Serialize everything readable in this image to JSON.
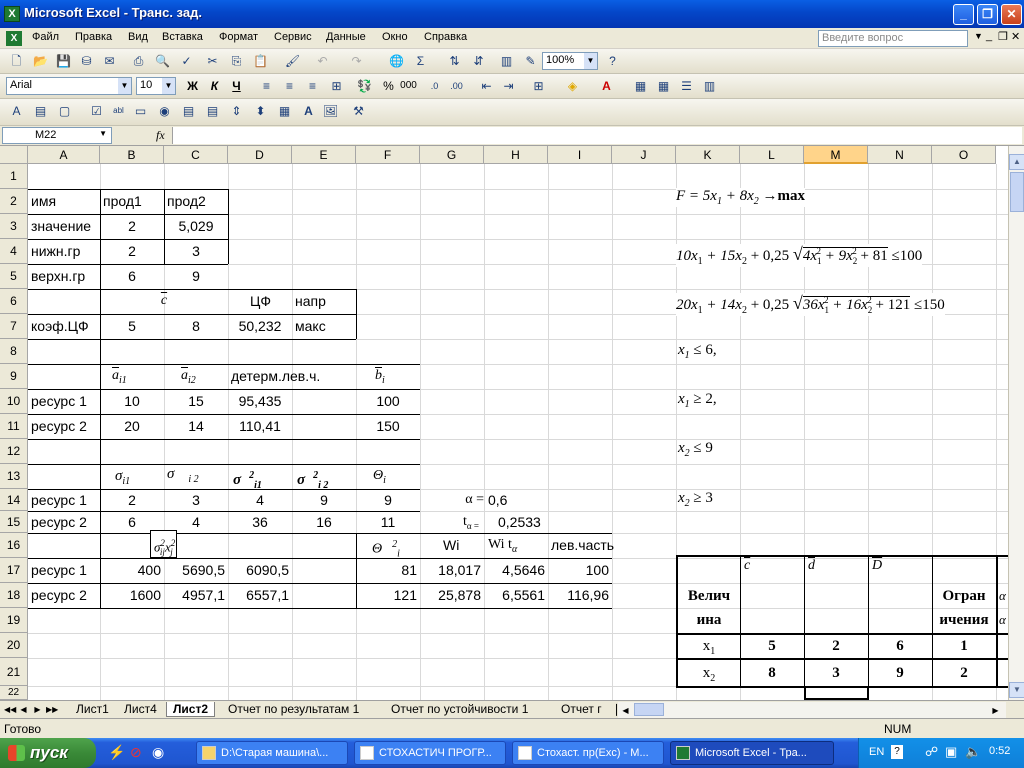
{
  "window": {
    "title": "Microsoft Excel - Транс. зад.",
    "min": "_",
    "restore": "❐",
    "close": "✕"
  },
  "menu": {
    "items": [
      "Файл",
      "Правка",
      "Вид",
      "Вставка",
      "Формат",
      "Сервис",
      "Данные",
      "Окно",
      "Справка"
    ],
    "help_placeholder": "Введите вопрос"
  },
  "toolbar": {
    "zoom": "100%",
    "font": "Arial",
    "size": "10",
    "bold": "Ж",
    "italic": "К",
    "underline": "Ч",
    "percent": "%",
    "thousands": "000",
    "sigma": "Σ"
  },
  "formula": {
    "name_box": "M22",
    "fx": "fx",
    "value": ""
  },
  "columns": [
    "A",
    "B",
    "C",
    "D",
    "E",
    "F",
    "G",
    "H",
    "I",
    "J",
    "K",
    "L",
    "M",
    "N",
    "O"
  ],
  "rows": [
    "1",
    "2",
    "3",
    "4",
    "5",
    "6",
    "7",
    "8",
    "9",
    "10",
    "11",
    "12",
    "13",
    "14",
    "15",
    "16",
    "17",
    "18",
    "19",
    "20",
    "21",
    "22"
  ],
  "cells": {
    "a2": "имя",
    "b2": "прод1",
    "c2": "прод2",
    "a3": "значение",
    "b3": "2",
    "c3": "5,029",
    "a4": "нижн.гр",
    "b4": "2",
    "c4": "3",
    "a5": "верхн.гр",
    "b5": "6",
    "c5": "9",
    "c6": "c",
    "d6": "ЦФ",
    "e6": "напр",
    "a7": "коэф.ЦФ",
    "b7": "5",
    "c7": "8",
    "d7": "50,232",
    "e7": "макс",
    "b9_base": "a",
    "b9_sub": "i1",
    "c9_base": "a",
    "c9_sub": "i2",
    "d9": "детерм.лев.ч.",
    "f9_base": "b",
    "f9_sub": "i",
    "a10": "ресурс 1",
    "b10": "10",
    "c10": "15",
    "d10": "95,435",
    "f10": "100",
    "a11": "ресурс 2",
    "b11": "20",
    "c11": "14",
    "d11": "110,41",
    "f11": "150",
    "b13_base": "σ",
    "b13_sub": "i1",
    "c13_base": "σ",
    "c13_sub": "i 2",
    "d13_base": "σ",
    "d13_sup": "2",
    "d13_sub": "i1",
    "e13_base": "σ",
    "e13_sup": "2",
    "e13_sub": "i 2",
    "f13_base": "Θ",
    "f13_sub": "i",
    "a14": "ресурс 1",
    "b14": "2",
    "c14": "3",
    "d14": "4",
    "e14": "9",
    "f14": "9",
    "g14": "α =",
    "h14": "0,6",
    "a15": "ресурс 2",
    "b15": "6",
    "c15": "4",
    "d15": "36",
    "e15": "16",
    "f15": "11",
    "g15": "t",
    "g15_sub": "α =",
    "h15": "0,2533",
    "b16_base": "σ",
    "b16_sup": "2",
    "b16_sub": "ij",
    "b16_x": "x",
    "b16_xsup": "2",
    "b16_xsub": "j",
    "f16_base": "Θ",
    "f16_sup": "2",
    "f16_sub": "i",
    "g16": "Wi",
    "h16": "Wi t",
    "h16_sub": "α",
    "i16": "лев.часть",
    "a17": "ресурс 1",
    "b17": "400",
    "c17": "5690,5",
    "d17": "6090,5",
    "f17": "81",
    "g17": "18,017",
    "h17": "4,5646",
    "i17": "100",
    "a18": "ресурс 2",
    "b18": "1600",
    "c18": "4957,1",
    "d18": "6557,1",
    "f18": "121",
    "g18": "25,878",
    "h18": "6,5561",
    "i18": "116,96"
  },
  "math": {
    "f": "F = 5x",
    "f_sub1": "1",
    "f_mid": " + 8x",
    "f_sub2": "2",
    "f_tail": " →max",
    "c1_a": "10x",
    "c1_s1": "1",
    "c1_b": " + 15x",
    "c1_s2": "2",
    "c1_c": " + 0,25",
    "c1_r1": "4x",
    "c1_r1s": "1",
    "c1_r1p": "2",
    "c1_r2": " + 9x",
    "c1_r2s": "2",
    "c1_r2p": "2",
    "c1_r3": " + 81",
    "c1_rel": "≤100",
    "c2_a": "20x",
    "c2_s1": "1",
    "c2_b": " + 14x",
    "c2_s2": "2",
    "c2_c": " + 0,25",
    "c2_r1": "36x",
    "c2_r1s": "1",
    "c2_r1p": "2",
    "c2_r2": " + 16x",
    "c2_r2s": "2",
    "c2_r2p": "2",
    "c2_r3": " + 121",
    "c2_rel": "≤150",
    "b1": "x",
    "b1s": "1",
    "b1r": " ≤ 6,",
    "b2": "x",
    "b2s": "1",
    "b2r": " ≥ 2,",
    "b3": "x",
    "b3s": "2",
    "b3r": " ≤ 9",
    "b4": "x",
    "b4s": "2",
    "b4r": " ≥ 3"
  },
  "table2": {
    "h_c": "c",
    "h_d": "d",
    "h_D": "D",
    "h_name_1": "Велич",
    "h_name_2": "ина",
    "h_lim_1": "Огран",
    "h_lim_2": "ичения",
    "h_extra_1": "α",
    "h_extra_2": "α",
    "r1_name": "x",
    "r1_sub": "1",
    "r1_c": "5",
    "r1_d": "2",
    "r1_D": "6",
    "r1_lim": "1",
    "r2_name": "x",
    "r2_sub": "2",
    "r2_c": "8",
    "r2_d": "3",
    "r2_D": "9",
    "r2_lim": "2"
  },
  "sheets": {
    "tabs": [
      "Лист1",
      "Лист4",
      "Лист2",
      "Отчет по результатам 1",
      "Отчет по устойчивости 1",
      "Отчет г"
    ]
  },
  "status": {
    "ready": "Готово",
    "num": "NUM"
  },
  "taskbar": {
    "start": "пуск",
    "tasks": [
      "D:\\Старая машина\\...",
      "СТОХАСТИЧ ПРОГР...",
      "Стохаст. пр(Exc) - M...",
      "Microsoft Excel - Тра..."
    ],
    "lang": "EN",
    "time": "0:52"
  }
}
